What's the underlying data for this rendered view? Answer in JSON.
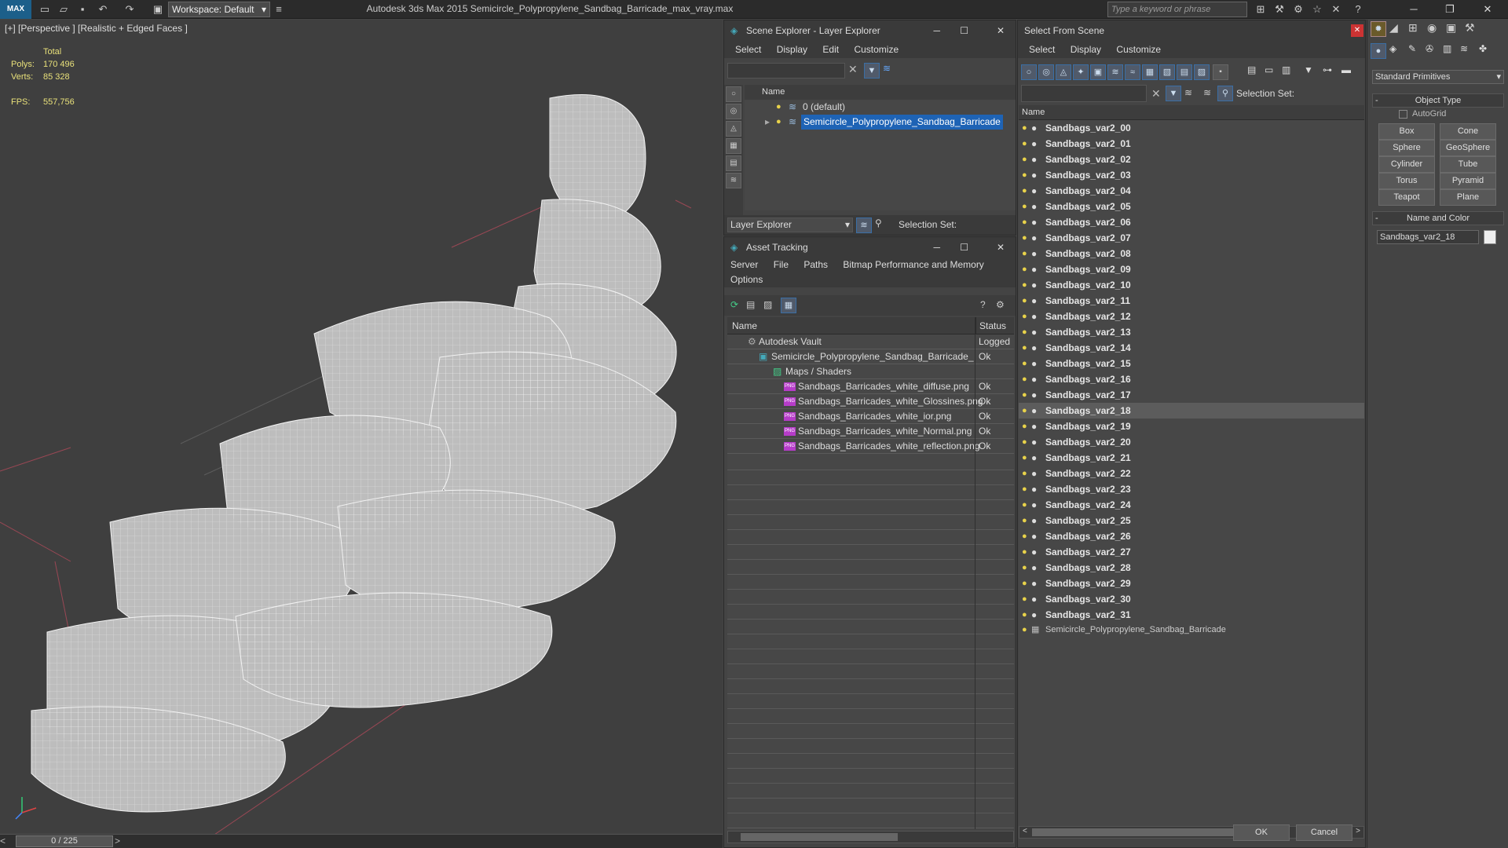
{
  "app": {
    "title": "Autodesk 3ds Max  2015    Semicircle_Polypropylene_Sandbag_Barricade_max_vray.max",
    "logo": "MAX",
    "workspace": "Workspace: Default",
    "search_placeholder": "Type a keyword or phrase"
  },
  "viewport": {
    "label": "[+] [Perspective ] [Realistic + Edged Faces ]",
    "stats": {
      "total_label": "Total",
      "polys_label": "Polys:",
      "polys": "170 496",
      "verts_label": "Verts:",
      "verts": "85 328",
      "fps_label": "FPS:",
      "fps": "557,756"
    },
    "timeline": "0 / 225"
  },
  "scene_explorer": {
    "title": "Scene Explorer - Layer Explorer",
    "menu": [
      "Select",
      "Display",
      "Edit",
      "Customize"
    ],
    "column": "Name",
    "layers": [
      "0 (default)",
      "Semicircle_Polypropylene_Sandbag_Barricade"
    ],
    "footer_dropdown": "Layer Explorer",
    "selection_set": "Selection Set:"
  },
  "asset_tracking": {
    "title": "Asset Tracking",
    "menu": [
      "Server",
      "File",
      "Paths",
      "Bitmap Performance and Memory"
    ],
    "menu2": "Options",
    "col_name": "Name",
    "col_status": "Status",
    "rows": [
      {
        "name": "Autodesk Vault",
        "status": "Logged"
      },
      {
        "name": "Semicircle_Polypropylene_Sandbag_Barricade_...",
        "status": "Ok"
      },
      {
        "name": "Maps / Shaders",
        "status": ""
      },
      {
        "name": "Sandbags_Barricades_white_diffuse.png",
        "status": "Ok"
      },
      {
        "name": "Sandbags_Barricades_white_Glossines.png",
        "status": "Ok"
      },
      {
        "name": "Sandbags_Barricades_white_ior.png",
        "status": "Ok"
      },
      {
        "name": "Sandbags_Barricades_white_Normal.png",
        "status": "Ok"
      },
      {
        "name": "Sandbags_Barricades_white_reflection.png",
        "status": "Ok"
      }
    ]
  },
  "select_from_scene": {
    "title": "Select From Scene",
    "menu": [
      "Select",
      "Display",
      "Customize"
    ],
    "selection_set": "Selection Set:",
    "column": "Name",
    "objects": [
      "Sandbags_var2_00",
      "Sandbags_var2_01",
      "Sandbags_var2_02",
      "Sandbags_var2_03",
      "Sandbags_var2_04",
      "Sandbags_var2_05",
      "Sandbags_var2_06",
      "Sandbags_var2_07",
      "Sandbags_var2_08",
      "Sandbags_var2_09",
      "Sandbags_var2_10",
      "Sandbags_var2_11",
      "Sandbags_var2_12",
      "Sandbags_var2_13",
      "Sandbags_var2_14",
      "Sandbags_var2_15",
      "Sandbags_var2_16",
      "Sandbags_var2_17",
      "Sandbags_var2_18",
      "Sandbags_var2_19",
      "Sandbags_var2_20",
      "Sandbags_var2_21",
      "Sandbags_var2_22",
      "Sandbags_var2_23",
      "Sandbags_var2_24",
      "Sandbags_var2_25",
      "Sandbags_var2_26",
      "Sandbags_var2_27",
      "Sandbags_var2_28",
      "Sandbags_var2_29",
      "Sandbags_var2_30",
      "Sandbags_var2_31"
    ],
    "group": "Semicircle_Polypropylene_Sandbag_Barricade",
    "selected_index": 18,
    "ok": "OK",
    "cancel": "Cancel"
  },
  "command_panel": {
    "dropdown": "Standard Primitives",
    "object_type": "Object Type",
    "autogrid": "AutoGrid",
    "buttons": [
      "Box",
      "Cone",
      "Sphere",
      "GeoSphere",
      "Cylinder",
      "Tube",
      "Torus",
      "Pyramid",
      "Teapot",
      "Plane"
    ],
    "name_and_color": "Name and Color",
    "name_value": "Sandbags_var2_18"
  }
}
